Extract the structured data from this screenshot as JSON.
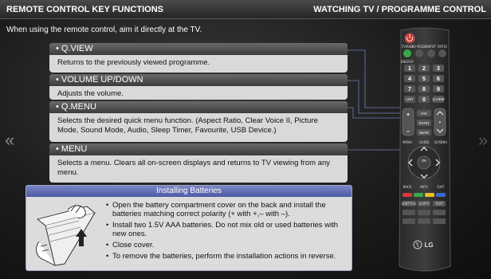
{
  "header": {
    "title": "REMOTE CONTROL KEY FUNCTIONS",
    "section": "WATCHING TV / PROGRAMME CONTROL"
  },
  "intro": "When using the remote control, aim it directly at the TV.",
  "nav": {
    "prev_glyph": "«",
    "next_glyph": "»"
  },
  "functions": [
    {
      "name": "• Q.VIEW",
      "desc": "Returns to the previously viewed programme."
    },
    {
      "name": "• VOLUME UP/DOWN",
      "desc": "Adjusts the volume."
    },
    {
      "name": "• Q.MENU",
      "desc": "Selects the desired quick menu function. (Aspect Ratio, Clear Voice II, Picture Mode, Sound Mode, Audio, Sleep Timer, Favourite, USB Device.)"
    },
    {
      "name": "• MENU",
      "desc": "Selects a menu. Clears all on-screen displays and returns to TV viewing from any menu."
    }
  ],
  "batteries": {
    "title": "Installing Batteries",
    "steps": [
      "Open the battery compartment cover on the back and install the batteries matching correct polarity (+ with +,– with –).",
      "Install two 1.5V AAA batteries. Do not mix old or used batteries with new ones.",
      "Close cover.",
      "To remove the batteries, perform the installation actions in reverse."
    ]
  },
  "remote": {
    "brand": "LG",
    "top_labels": [
      "TV/RAD",
      "AV MODE",
      "INPUT",
      "RATIO"
    ],
    "energy_label": "ENERGY",
    "numbers": [
      "1",
      "2",
      "3",
      "4",
      "5",
      "6",
      "7",
      "8",
      "9",
      "LIST",
      "0",
      "Q.VIEW"
    ],
    "side_labels": [
      "FAV",
      "RATIO",
      "MUTE",
      "P"
    ],
    "nav_labels": [
      "MENU",
      "GUIDE",
      "Q.MENU"
    ],
    "ok_label": "OK",
    "bottom_labels": [
      "BACK",
      "INFO",
      "EXIT"
    ],
    "func_row1": [
      "SUBTITLE",
      "Q.MTP",
      "TEXT"
    ],
    "accent_colors": {
      "red": "#d63a3a",
      "green": "#3aa84a",
      "yellow": "#e6c02a",
      "blue": "#3a6ad0",
      "power": "#c8322e",
      "callout_line": "#7080c0"
    }
  }
}
